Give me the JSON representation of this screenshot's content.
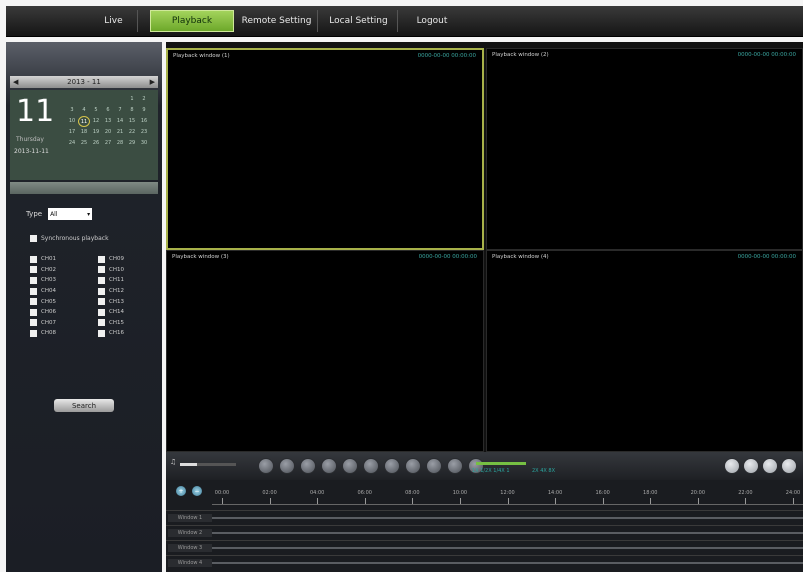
{
  "nav": {
    "tabs": [
      {
        "label": "Live",
        "active": false
      },
      {
        "label": "Playback",
        "active": true
      },
      {
        "label": "Remote Setting",
        "active": false
      },
      {
        "label": "Local Setting",
        "active": false
      },
      {
        "label": "Logout",
        "active": false
      }
    ]
  },
  "calendar": {
    "month_label": "2013 - 11",
    "prev_icon": "chevron-left-icon",
    "next_icon": "chevron-right-icon",
    "day_number": "11",
    "day_name": "Thursday",
    "date_string": "2013-11-11",
    "days": [
      "",
      "",
      "",
      "",
      "",
      "1",
      "2",
      "3",
      "4",
      "5",
      "6",
      "7",
      "8",
      "9",
      "10",
      "11",
      "12",
      "13",
      "14",
      "15",
      "16",
      "17",
      "18",
      "19",
      "20",
      "21",
      "22",
      "23",
      "24",
      "25",
      "26",
      "27",
      "28",
      "29",
      "30"
    ],
    "selected_day": "11"
  },
  "filters": {
    "type_label": "Type",
    "type_value": "All",
    "sync_label": "Synchronous playback"
  },
  "channels": {
    "left": [
      "CH01",
      "CH02",
      "CH03",
      "CH04",
      "CH05",
      "CH06",
      "CH07",
      "CH08"
    ],
    "right": [
      "CH09",
      "CH10",
      "CH11",
      "CH12",
      "CH13",
      "CH14",
      "CH15",
      "CH16"
    ]
  },
  "search_button": "Search",
  "video": {
    "panes": [
      {
        "label": "Playback window (1)",
        "time": "0000-00-00 00:00:00",
        "active": true
      },
      {
        "label": "Playback window (2)",
        "time": "0000-00-00 00:00:00",
        "active": false
      },
      {
        "label": "Playback window (3)",
        "time": "0000-00-00 00:00:00",
        "active": false
      },
      {
        "label": "Playback window (4)",
        "time": "0000-00-00 00:00:00",
        "active": false
      }
    ]
  },
  "controls": {
    "volume_level": 0.3,
    "playback_buttons": [
      "play-icon",
      "pause-icon",
      "stop-icon",
      "slow-icon",
      "fast-icon",
      "frame-icon",
      "prev-icon",
      "next-icon",
      "capture-icon",
      "record-icon",
      "sound-icon"
    ],
    "speed_left_text": "1X 1/2X 1/4X 1",
    "speed_right_text": "2X 4X 8X",
    "right_buttons": [
      "fullscreen-icon",
      "layout-1-icon",
      "layout-4-icon",
      "layout-9-icon"
    ]
  },
  "timeline": {
    "hours": [
      "00:00",
      "02:00",
      "04:00",
      "06:00",
      "08:00",
      "10:00",
      "12:00",
      "14:00",
      "16:00",
      "18:00",
      "20:00",
      "22:00",
      "24:00"
    ],
    "tracks": [
      "Window 1",
      "Window 2",
      "Window 3",
      "Window 4"
    ]
  },
  "colors": {
    "accent_green": "#8cc63f",
    "active_pane_border": "#a8b24a",
    "timestamp_teal": "#3aa6a0"
  }
}
